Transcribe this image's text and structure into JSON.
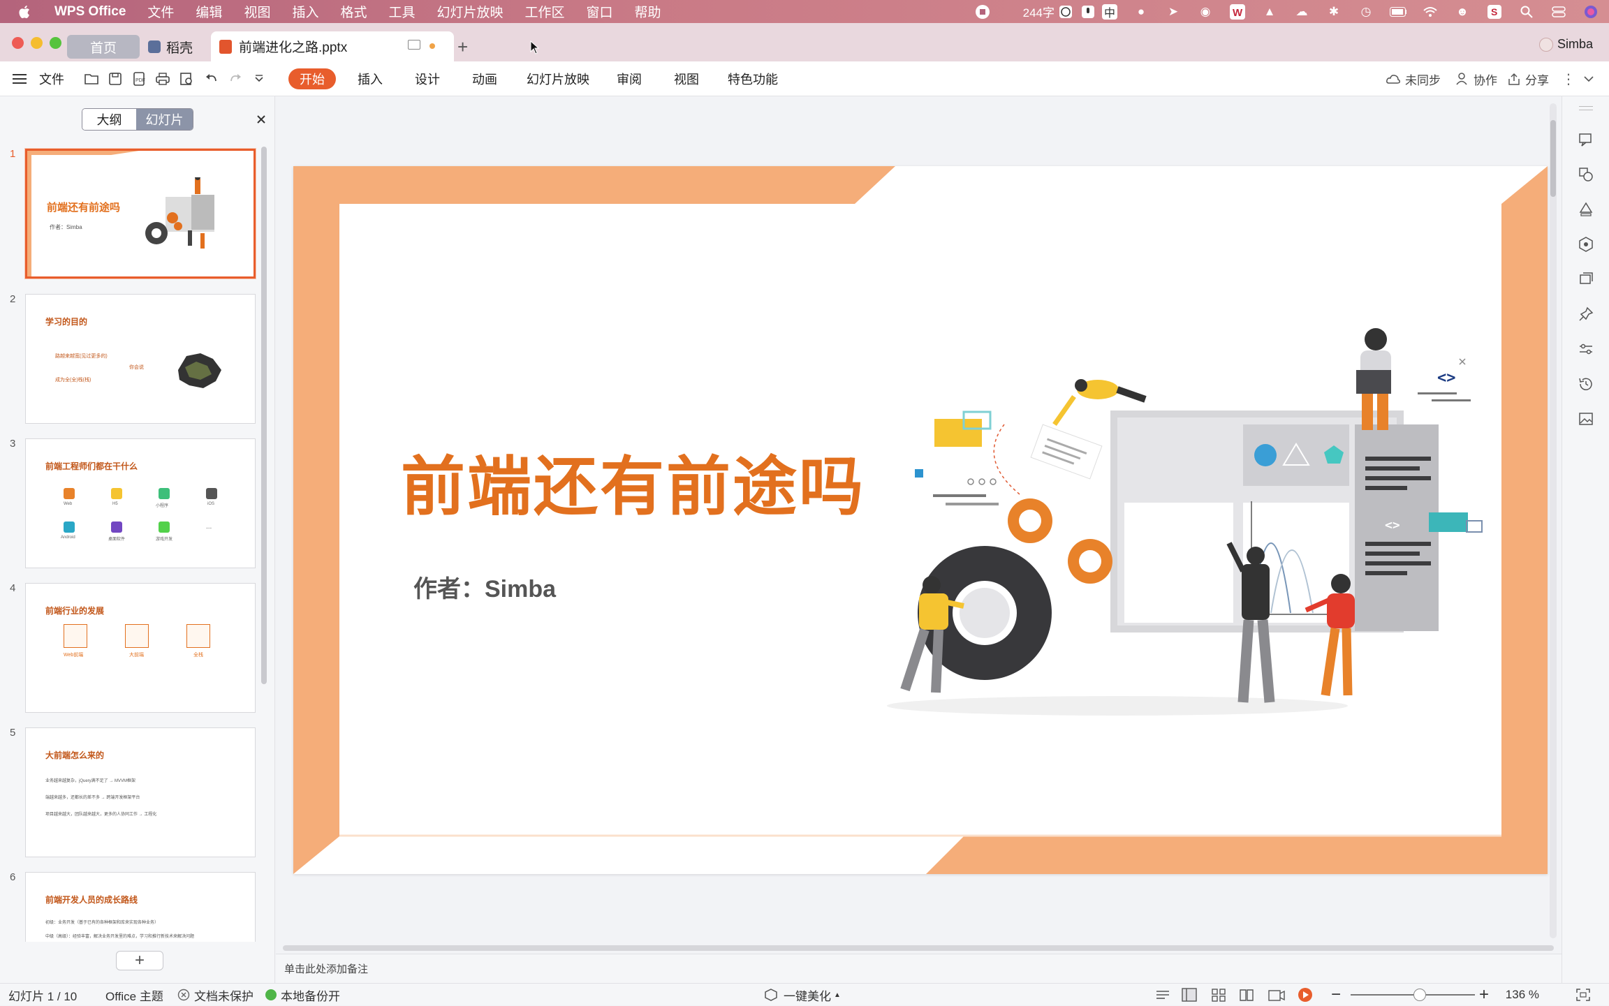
{
  "menubar": {
    "app_name": "WPS Office",
    "items": [
      "文件",
      "编辑",
      "视图",
      "插入",
      "格式",
      "工具",
      "幻灯片放映",
      "工作区",
      "窗口",
      "帮助"
    ],
    "word_count": "244字",
    "input_method": "中"
  },
  "tabs": {
    "home": "首页",
    "daoke": "稻壳",
    "document": "前端进化之路.pptx",
    "user": "Simba"
  },
  "toolbar": {
    "file_label": "文件",
    "ribbon_tabs": [
      "开始",
      "插入",
      "设计",
      "动画",
      "幻灯片放映",
      "审阅",
      "视图",
      "特色功能"
    ],
    "active_tab": "开始",
    "sync": "未同步",
    "collab": "协作",
    "share": "分享"
  },
  "sidebar": {
    "outline_tab": "大纲",
    "slides_tab": "幻灯片",
    "thumbnails": [
      {
        "num": "1",
        "title": "前端还有前途吗",
        "sub": "作者：Simba"
      },
      {
        "num": "2",
        "title": "学习的目的",
        "lines": [
          "路越来越宽(见过更多的)",
          "成为全(全)栈(栈)"
        ],
        "badge": "你会说"
      },
      {
        "num": "3",
        "title": "前端工程师们都在干什么",
        "icons": [
          "Web",
          "H5",
          "小程序",
          "iOS",
          "Android",
          "桌面软件",
          "游戏开发",
          "..."
        ]
      },
      {
        "num": "4",
        "title": "前端行业的发展",
        "cols": [
          "Web前端",
          "大前端",
          "全栈"
        ]
      },
      {
        "num": "5",
        "title": "大前端怎么来的",
        "lines": [
          "业务越来越复杂，jQuery满不足了 → MVVM框架",
          "端越来越多，还都长的差不多 → 跨端开发框架平台",
          "项目越来越大，团队越来越大，更多的人协同工作 → 工程化"
        ]
      },
      {
        "num": "6",
        "title": "前端开发人员的成长路线",
        "lines": [
          "初级：业务开发（基于已有的各种框架和库来实现各种业务）",
          "中级（高级）：经验丰富，解决业务开发里的难点，学习和推行新技术来解决问题"
        ]
      }
    ]
  },
  "slide": {
    "title": "前端还有前途吗",
    "author": "作者：Simba"
  },
  "notes_placeholder": "单击此处添加备注",
  "statusbar": {
    "slide_counter": "幻灯片 1 / 10",
    "theme": "Office 主题",
    "protection": "文档未保护",
    "backup": "本地备份开",
    "beautify": "一键美化",
    "zoom": "136 %"
  },
  "colors": {
    "accent": "#e85d2c",
    "title_orange": "#e2701e",
    "frame_orange": "#f5ad79"
  }
}
